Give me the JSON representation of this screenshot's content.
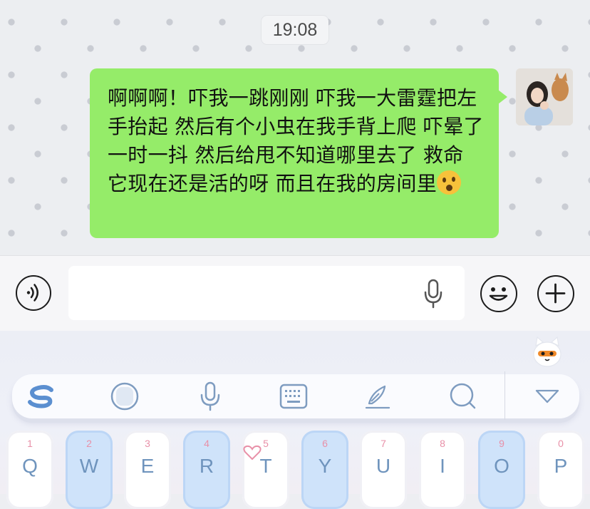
{
  "chat": {
    "timestamp": "19:08",
    "message": {
      "sender": "self",
      "text": "啊啊啊！吓我一跳刚刚 吓我一大雷霆把左手抬起 然后有个小虫在我手背上爬 吓晕了 一时一抖 然后给甩不知道哪里去了 救命 它现在还是活的呀 而且在我的房间里",
      "emoji": "astonished-face"
    },
    "avatar_alt": "user-avatar"
  },
  "input_bar": {
    "voice_button": "voice-mode-icon",
    "text_value": "",
    "mic_icon": "microphone-icon",
    "emoji_button": "smiley-icon",
    "more_button": "plus-icon"
  },
  "keyboard": {
    "toolbar": [
      {
        "name": "sogou-logo-icon"
      },
      {
        "name": "emoji-panel-icon"
      },
      {
        "name": "microphone-icon"
      },
      {
        "name": "keyboard-layout-icon"
      },
      {
        "name": "handwriting-pen-icon"
      },
      {
        "name": "search-icon"
      },
      {
        "name": "collapse-keyboard-icon"
      }
    ],
    "keys": [
      {
        "num": "1",
        "letter": "Q"
      },
      {
        "num": "2",
        "letter": "W"
      },
      {
        "num": "3",
        "letter": "E"
      },
      {
        "num": "4",
        "letter": "R"
      },
      {
        "num": "5",
        "letter": "T"
      },
      {
        "num": "6",
        "letter": "Y"
      },
      {
        "num": "7",
        "letter": "U"
      },
      {
        "num": "8",
        "letter": "I"
      },
      {
        "num": "9",
        "letter": "O"
      },
      {
        "num": "0",
        "letter": "P"
      }
    ]
  },
  "colors": {
    "bubble": "#95ec69",
    "chat_bg": "#eceef1",
    "key_blue": "#cfe3fa",
    "key_text": "#6f94bd",
    "key_number": "#e890a8"
  }
}
